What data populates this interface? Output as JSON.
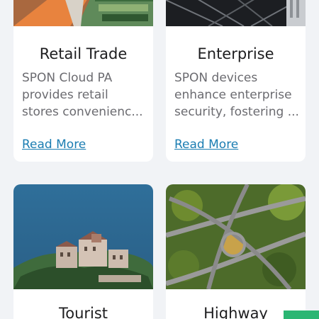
{
  "cards": [
    {
      "title": "Retail Trade",
      "desc_lines": [
        "SPON Cloud PA",
        "provides retail",
        "stores convenienc..."
      ],
      "link": "Read More"
    },
    {
      "title": "Enterprise",
      "desc_lines": [
        "SPON devices",
        "enhance enterprise",
        "security, fostering ..."
      ],
      "link": "Read More"
    },
    {
      "title": "Tourist"
    },
    {
      "title": "Highway"
    }
  ],
  "colors": {
    "accent_link": "#1b7db2",
    "fab": "#2bb673",
    "background": "#f1f3f6"
  }
}
